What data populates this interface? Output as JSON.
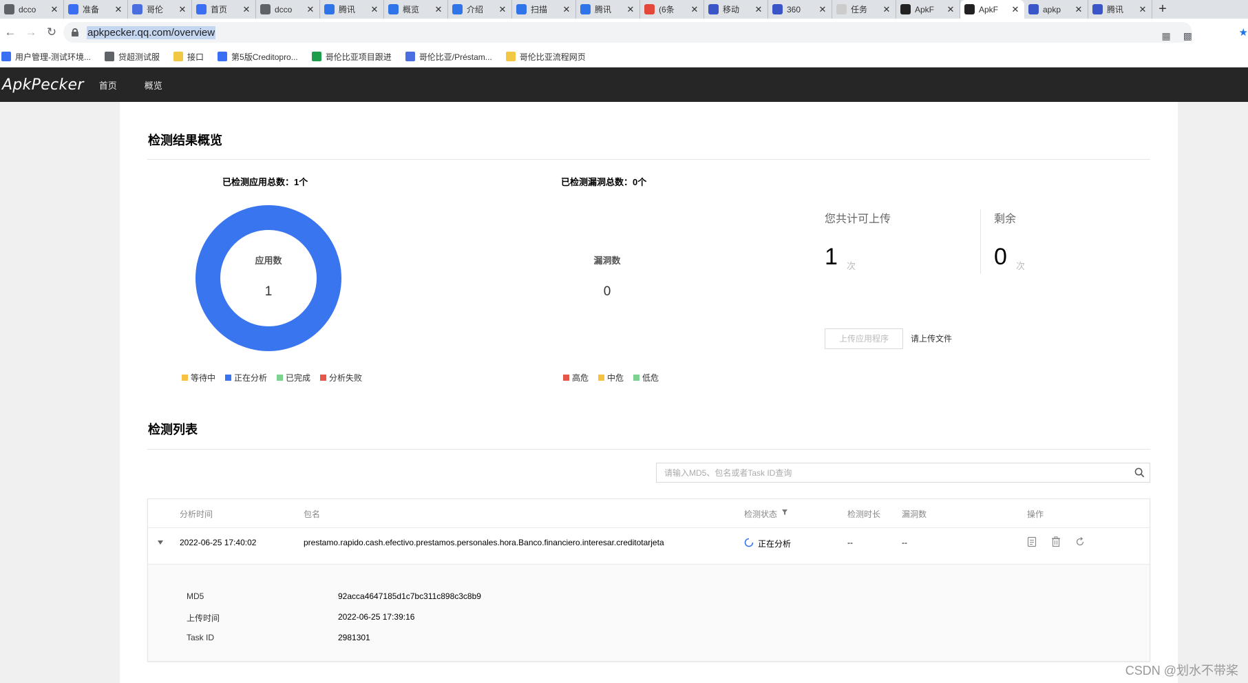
{
  "browser": {
    "tabs": [
      {
        "label": "dcco",
        "color": "#5f6368",
        "active": false
      },
      {
        "label": "准备",
        "color": "#3b6ff3",
        "active": false
      },
      {
        "label": "哥伦",
        "color": "#4a6ee0",
        "active": false
      },
      {
        "label": "首页",
        "color": "#3b6ff3",
        "active": false
      },
      {
        "label": "dcco",
        "color": "#5f6368",
        "active": false
      },
      {
        "label": "腾讯",
        "color": "#2f74e8",
        "active": false
      },
      {
        "label": "概览",
        "color": "#2f74e8",
        "active": false
      },
      {
        "label": "介绍",
        "color": "#2f74e8",
        "active": false
      },
      {
        "label": "扫描",
        "color": "#2f74e8",
        "active": false
      },
      {
        "label": "腾讯",
        "color": "#2f74e8",
        "active": false
      },
      {
        "label": "(6条",
        "color": "#e4483b",
        "active": false
      },
      {
        "label": "移动",
        "color": "#3a55c8",
        "active": false
      },
      {
        "label": "360",
        "color": "#3a55c8",
        "active": false
      },
      {
        "label": "任务",
        "color": "#cccccc",
        "active": false
      },
      {
        "label": "ApkF",
        "color": "#222222",
        "active": false
      },
      {
        "label": "ApkF",
        "color": "#222222",
        "active": true
      },
      {
        "label": "apkp",
        "color": "#3a55c8",
        "active": false
      },
      {
        "label": "腾讯",
        "color": "#3a55c8",
        "active": false
      }
    ],
    "new_tab": "+",
    "url": "apkpecker.qq.com/overview",
    "bookmarks": [
      {
        "label": "用户管理-测试环境...",
        "color": "#3b6ff3"
      },
      {
        "label": "贷超测试服",
        "color": "#5f6368"
      },
      {
        "label": "接口",
        "color": "#f2c744"
      },
      {
        "label": "第5版Creditopro...",
        "color": "#3b6ff3"
      },
      {
        "label": "哥伦比亚项目跟进",
        "color": "#1e9e4a"
      },
      {
        "label": "哥伦比亚/Préstam...",
        "color": "#4a6ee0"
      },
      {
        "label": "哥伦比亚流程网页",
        "color": "#f2c744"
      }
    ]
  },
  "app": {
    "logo": "ApkPecker",
    "nav": [
      "首页",
      "概览"
    ]
  },
  "overview": {
    "title": "检测结果概览",
    "apps_stat": "已检测应用总数：1个",
    "apps_label": "应用数",
    "apps_value": "1",
    "apps_legend": [
      {
        "label": "等待中",
        "color": "#f5c242"
      },
      {
        "label": "正在分析",
        "color": "#3a75f0"
      },
      {
        "label": "已完成",
        "color": "#7ed28f"
      },
      {
        "label": "分析失败",
        "color": "#e5574a"
      }
    ],
    "vuln_stat": "已检测漏洞总数：0个",
    "vuln_label": "漏洞数",
    "vuln_value": "0",
    "vuln_legend": [
      {
        "label": "高危",
        "color": "#e5574a"
      },
      {
        "label": "中危",
        "color": "#f5c242"
      },
      {
        "label": "低危",
        "color": "#7ed28f"
      }
    ],
    "quota_label": "您共计可上传",
    "quota_value": "1",
    "quota_unit": "次",
    "remain_label": "剩余",
    "remain_value": "0",
    "remain_unit": "次",
    "upload_button": "上传应用程序",
    "upload_hint": "请上传文件"
  },
  "list": {
    "title": "检测列表",
    "search_placeholder": "请输入MD5、包名或者Task ID查询",
    "columns": {
      "time": "分析时间",
      "package": "包名",
      "status": "检测状态",
      "duration": "检测时长",
      "vulns": "漏洞数",
      "actions": "操作"
    },
    "row": {
      "time": "2022-06-25 17:40:02",
      "package": "prestamo.rapido.cash.efectivo.prestamos.personales.hora.Banco.financiero.interesar.creditotarjeta",
      "status": "正在分析",
      "duration": "--",
      "vulns": "--"
    },
    "detail": {
      "md5_label": "MD5",
      "md5_value": "92acca4647185d1c7bc311c898c3c8b9",
      "upload_label": "上传时间",
      "upload_value": "2022-06-25 17:39:16",
      "task_label": "Task ID",
      "task_value": "2981301"
    }
  },
  "watermark": "CSDN @划水不带桨"
}
